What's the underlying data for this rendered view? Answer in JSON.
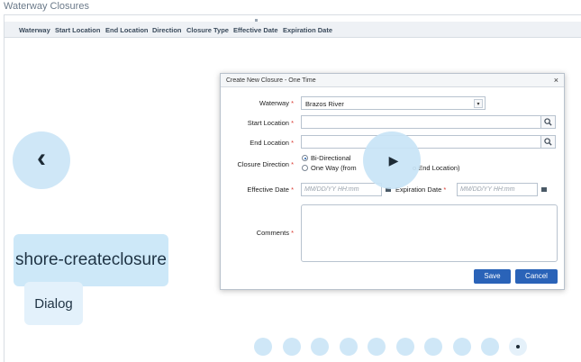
{
  "page": {
    "title": "Waterway Closures"
  },
  "table": {
    "columns": [
      "Waterway",
      "Start Location",
      "End Location",
      "Direction",
      "Closure Type",
      "Effective Date",
      "Expiration Date"
    ]
  },
  "dialog": {
    "title": "Create New Closure - One Time",
    "close_glyph": "×",
    "required_mark": "*",
    "waterway": {
      "label": "Waterway",
      "value": "Brazos River"
    },
    "start_location": {
      "label": "Start Location",
      "value": ""
    },
    "end_location": {
      "label": "End Location",
      "value": ""
    },
    "closure_direction": {
      "label": "Closure Direction",
      "options": [
        "Bi-Directional",
        "One Way (from",
        "o End Location)"
      ],
      "selected": "Bi-Directional"
    },
    "effective_date": {
      "label": "Effective Date",
      "placeholder": "MM/DD/YY HH:mm"
    },
    "expiration_date": {
      "label": "Expiration Date",
      "placeholder": "MM/DD/YY HH:mm"
    },
    "comments": {
      "label": "Comments",
      "value": ""
    },
    "save_label": "Save",
    "cancel_label": "Cancel"
  },
  "overlay": {
    "prev_glyph": "‹",
    "play_glyph": "▶",
    "slide_name": "shore-createclosure",
    "slide_type": "Dialog",
    "dots_count": 10,
    "active_dot": 10
  },
  "icons": {
    "search": "search-icon",
    "calendar": "calendar-icon",
    "dropdown": "chevron-down-icon"
  },
  "colors": {
    "primary_button": "#2a63b8",
    "overlay_bubble": "#cfe7f7",
    "required": "#d9342b"
  }
}
